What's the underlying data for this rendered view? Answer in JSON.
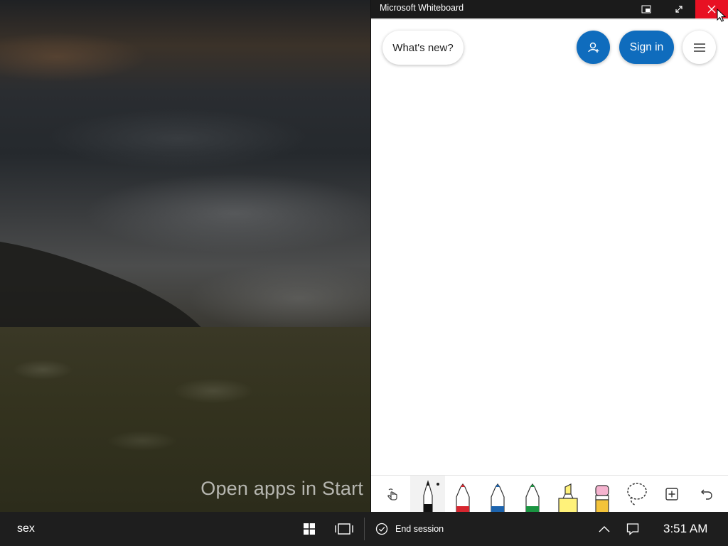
{
  "desktop": {
    "hint_text": "Open apps in Start"
  },
  "app": {
    "title": "Microsoft Whiteboard",
    "titlebar_buttons": [
      "compact-overlay-icon",
      "fullscreen-icon",
      "close-icon"
    ],
    "whats_new_label": "What's new?",
    "sign_in_label": "Sign in",
    "toolbar": [
      {
        "name": "touch-draw-toggle-icon"
      },
      {
        "name": "pen-black",
        "color": "#111111"
      },
      {
        "name": "pen-red",
        "color": "#d6262f"
      },
      {
        "name": "pen-blue",
        "color": "#1d64ae"
      },
      {
        "name": "pen-green",
        "color": "#1a9441"
      },
      {
        "name": "highlighter-yellow",
        "color": "#fff27a"
      },
      {
        "name": "eraser",
        "color": "#f5b3cf"
      },
      {
        "name": "lasso-select-icon"
      },
      {
        "name": "insert-icon"
      },
      {
        "name": "undo-icon"
      }
    ]
  },
  "taskbar": {
    "user_name": "sex",
    "end_session_label": "End session",
    "clock": "3:51 AM"
  },
  "colors": {
    "accent": "#0f6cbd",
    "close": "#e81123",
    "taskbar": "#1e1e1e",
    "titlebar": "#1b1b1b"
  }
}
